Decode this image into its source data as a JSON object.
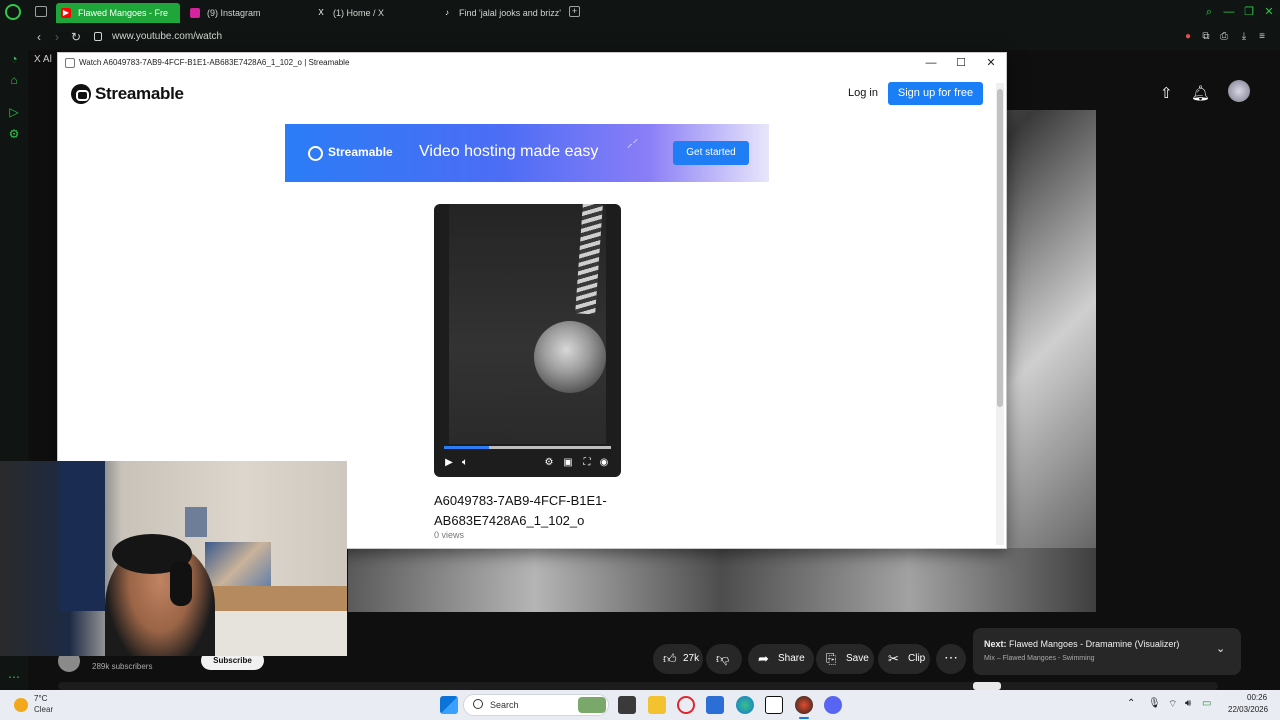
{
  "browser": {
    "tabs": [
      {
        "label": "Flawed Mangoes - Fre",
        "icon": "youtube-icon"
      },
      {
        "label": "(9) Instagram",
        "icon": "instagram-icon"
      },
      {
        "label": "(1) Home / X",
        "icon": "x-icon"
      },
      {
        "label": "Find 'jalal jooks and brizz'",
        "icon": "tiktok-icon"
      }
    ],
    "url": "www.youtube.com/watch",
    "sidebar_tab_prefix": "X  Al"
  },
  "popup": {
    "window_title": "Watch A6049783-7AB9-4FCF-B1E1-AB683E7428A6_1_102_o | Streamable",
    "brand": "Streamable",
    "login": "Log in",
    "signup": "Sign up for free",
    "banner": {
      "brand": "Streamable",
      "tagline": "Video hosting made easy",
      "cta": "Get started"
    },
    "video": {
      "title": "A6049783-7AB9-4FCF-B1E1-AB683E7428A6_1_102_o",
      "views": "0 views",
      "progress": 0.27
    }
  },
  "youtube": {
    "subscribers": "289k subscribers",
    "subscribe": "Subscribe",
    "likes": "27k",
    "share": "Share",
    "save": "Save",
    "clip": "Clip",
    "next": {
      "label": "Next:",
      "title": "Flawed Mangoes - Dramamine (Visualizer)",
      "subtitle": "Mix – Flawed Mangoes - Swimming"
    }
  },
  "taskbar": {
    "temp": "7°C",
    "condition": "Clear",
    "search": "Search",
    "time": "00:26",
    "date": "22/03/2026"
  },
  "colors": {
    "opera_accent": "#2ec94a",
    "streamable_blue": "#1a7ff6",
    "youtube_bg": "#0f0f0f"
  }
}
